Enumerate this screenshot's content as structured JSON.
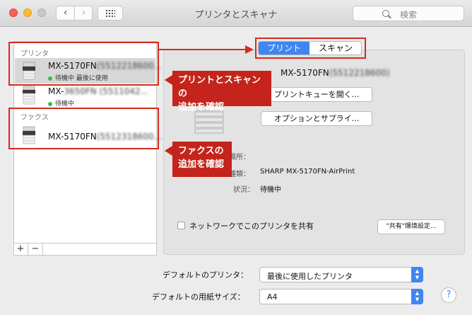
{
  "window": {
    "title": "プリンタとスキャナ",
    "search_placeholder": "検索"
  },
  "colors": {
    "accent_blue": "#3f86f0",
    "annotation_red": "#d52b1e",
    "status_green": "#3cb84a"
  },
  "sidebar": {
    "printers_header": "プリンタ",
    "fax_header": "ファクス",
    "items": [
      {
        "name": "MX-5170FN",
        "name_suffix": "(5512218600...",
        "status": "待機中 最後に使用"
      },
      {
        "name": "MX-",
        "name_suffix": "3650FN (5511042...",
        "status": "待機中"
      },
      {
        "name": "MX-5170FN",
        "name_suffix": "(5512318600...",
        "status": ""
      }
    ],
    "add_label": "+",
    "remove_label": "−"
  },
  "detail": {
    "tabs": [
      {
        "label": "プリント",
        "selected": true
      },
      {
        "label": "スキャン",
        "selected": false
      }
    ],
    "printer_name": "MX-5170FN",
    "printer_name_suffix": "(5512218600)",
    "open_queue_label": "プリントキューを開く...",
    "options_label": "オプションとサプライ...",
    "location_label": "場所：",
    "kind_label": "種類：",
    "kind_value": "SHARP MX-5170FN-AirPrint",
    "status_label": "状況：",
    "status_value": "待機中",
    "share_label": "ネットワークでこのプリンタを共有",
    "share_checked": false,
    "sharing_prefs_label": "\"共有\"環境設定..."
  },
  "defaults": {
    "default_printer_label": "デフォルトのプリンタ：",
    "default_printer_value": "最後に使用したプリンタ",
    "default_paper_label": "デフォルトの用紙サイズ：",
    "default_paper_value": "A4"
  },
  "annotations": {
    "print_scan": [
      "プリントとスキャンの",
      "追加を確認"
    ],
    "fax": [
      "ファクスの",
      "追加を確認"
    ]
  }
}
